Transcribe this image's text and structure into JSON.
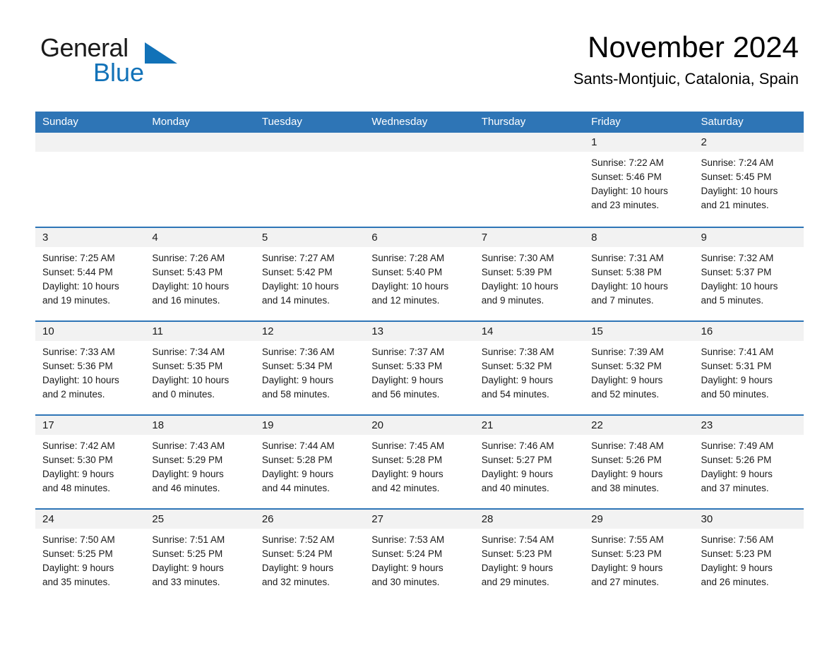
{
  "brand": {
    "line1": "General",
    "line2": "Blue",
    "triangle_color": "#1272b8"
  },
  "header": {
    "month_title": "November 2024",
    "location": "Sants-Montjuic, Catalonia, Spain"
  },
  "theme": {
    "header_blue": "#2e75b6",
    "day_band_gray": "#f2f2f2",
    "text": "#1a1a1a"
  },
  "calendar": {
    "weekday_headers": [
      "Sunday",
      "Monday",
      "Tuesday",
      "Wednesday",
      "Thursday",
      "Friday",
      "Saturday"
    ],
    "weeks": [
      [
        {
          "day": "",
          "empty": true
        },
        {
          "day": "",
          "empty": true
        },
        {
          "day": "",
          "empty": true
        },
        {
          "day": "",
          "empty": true
        },
        {
          "day": "",
          "empty": true
        },
        {
          "day": "1",
          "sunrise": "Sunrise: 7:22 AM",
          "sunset": "Sunset: 5:46 PM",
          "daylight_1": "Daylight: 10 hours",
          "daylight_2": "and 23 minutes."
        },
        {
          "day": "2",
          "sunrise": "Sunrise: 7:24 AM",
          "sunset": "Sunset: 5:45 PM",
          "daylight_1": "Daylight: 10 hours",
          "daylight_2": "and 21 minutes."
        }
      ],
      [
        {
          "day": "3",
          "sunrise": "Sunrise: 7:25 AM",
          "sunset": "Sunset: 5:44 PM",
          "daylight_1": "Daylight: 10 hours",
          "daylight_2": "and 19 minutes."
        },
        {
          "day": "4",
          "sunrise": "Sunrise: 7:26 AM",
          "sunset": "Sunset: 5:43 PM",
          "daylight_1": "Daylight: 10 hours",
          "daylight_2": "and 16 minutes."
        },
        {
          "day": "5",
          "sunrise": "Sunrise: 7:27 AM",
          "sunset": "Sunset: 5:42 PM",
          "daylight_1": "Daylight: 10 hours",
          "daylight_2": "and 14 minutes."
        },
        {
          "day": "6",
          "sunrise": "Sunrise: 7:28 AM",
          "sunset": "Sunset: 5:40 PM",
          "daylight_1": "Daylight: 10 hours",
          "daylight_2": "and 12 minutes."
        },
        {
          "day": "7",
          "sunrise": "Sunrise: 7:30 AM",
          "sunset": "Sunset: 5:39 PM",
          "daylight_1": "Daylight: 10 hours",
          "daylight_2": "and 9 minutes."
        },
        {
          "day": "8",
          "sunrise": "Sunrise: 7:31 AM",
          "sunset": "Sunset: 5:38 PM",
          "daylight_1": "Daylight: 10 hours",
          "daylight_2": "and 7 minutes."
        },
        {
          "day": "9",
          "sunrise": "Sunrise: 7:32 AM",
          "sunset": "Sunset: 5:37 PM",
          "daylight_1": "Daylight: 10 hours",
          "daylight_2": "and 5 minutes."
        }
      ],
      [
        {
          "day": "10",
          "sunrise": "Sunrise: 7:33 AM",
          "sunset": "Sunset: 5:36 PM",
          "daylight_1": "Daylight: 10 hours",
          "daylight_2": "and 2 minutes."
        },
        {
          "day": "11",
          "sunrise": "Sunrise: 7:34 AM",
          "sunset": "Sunset: 5:35 PM",
          "daylight_1": "Daylight: 10 hours",
          "daylight_2": "and 0 minutes."
        },
        {
          "day": "12",
          "sunrise": "Sunrise: 7:36 AM",
          "sunset": "Sunset: 5:34 PM",
          "daylight_1": "Daylight: 9 hours",
          "daylight_2": "and 58 minutes."
        },
        {
          "day": "13",
          "sunrise": "Sunrise: 7:37 AM",
          "sunset": "Sunset: 5:33 PM",
          "daylight_1": "Daylight: 9 hours",
          "daylight_2": "and 56 minutes."
        },
        {
          "day": "14",
          "sunrise": "Sunrise: 7:38 AM",
          "sunset": "Sunset: 5:32 PM",
          "daylight_1": "Daylight: 9 hours",
          "daylight_2": "and 54 minutes."
        },
        {
          "day": "15",
          "sunrise": "Sunrise: 7:39 AM",
          "sunset": "Sunset: 5:32 PM",
          "daylight_1": "Daylight: 9 hours",
          "daylight_2": "and 52 minutes."
        },
        {
          "day": "16",
          "sunrise": "Sunrise: 7:41 AM",
          "sunset": "Sunset: 5:31 PM",
          "daylight_1": "Daylight: 9 hours",
          "daylight_2": "and 50 minutes."
        }
      ],
      [
        {
          "day": "17",
          "sunrise": "Sunrise: 7:42 AM",
          "sunset": "Sunset: 5:30 PM",
          "daylight_1": "Daylight: 9 hours",
          "daylight_2": "and 48 minutes."
        },
        {
          "day": "18",
          "sunrise": "Sunrise: 7:43 AM",
          "sunset": "Sunset: 5:29 PM",
          "daylight_1": "Daylight: 9 hours",
          "daylight_2": "and 46 minutes."
        },
        {
          "day": "19",
          "sunrise": "Sunrise: 7:44 AM",
          "sunset": "Sunset: 5:28 PM",
          "daylight_1": "Daylight: 9 hours",
          "daylight_2": "and 44 minutes."
        },
        {
          "day": "20",
          "sunrise": "Sunrise: 7:45 AM",
          "sunset": "Sunset: 5:28 PM",
          "daylight_1": "Daylight: 9 hours",
          "daylight_2": "and 42 minutes."
        },
        {
          "day": "21",
          "sunrise": "Sunrise: 7:46 AM",
          "sunset": "Sunset: 5:27 PM",
          "daylight_1": "Daylight: 9 hours",
          "daylight_2": "and 40 minutes."
        },
        {
          "day": "22",
          "sunrise": "Sunrise: 7:48 AM",
          "sunset": "Sunset: 5:26 PM",
          "daylight_1": "Daylight: 9 hours",
          "daylight_2": "and 38 minutes."
        },
        {
          "day": "23",
          "sunrise": "Sunrise: 7:49 AM",
          "sunset": "Sunset: 5:26 PM",
          "daylight_1": "Daylight: 9 hours",
          "daylight_2": "and 37 minutes."
        }
      ],
      [
        {
          "day": "24",
          "sunrise": "Sunrise: 7:50 AM",
          "sunset": "Sunset: 5:25 PM",
          "daylight_1": "Daylight: 9 hours",
          "daylight_2": "and 35 minutes."
        },
        {
          "day": "25",
          "sunrise": "Sunrise: 7:51 AM",
          "sunset": "Sunset: 5:25 PM",
          "daylight_1": "Daylight: 9 hours",
          "daylight_2": "and 33 minutes."
        },
        {
          "day": "26",
          "sunrise": "Sunrise: 7:52 AM",
          "sunset": "Sunset: 5:24 PM",
          "daylight_1": "Daylight: 9 hours",
          "daylight_2": "and 32 minutes."
        },
        {
          "day": "27",
          "sunrise": "Sunrise: 7:53 AM",
          "sunset": "Sunset: 5:24 PM",
          "daylight_1": "Daylight: 9 hours",
          "daylight_2": "and 30 minutes."
        },
        {
          "day": "28",
          "sunrise": "Sunrise: 7:54 AM",
          "sunset": "Sunset: 5:23 PM",
          "daylight_1": "Daylight: 9 hours",
          "daylight_2": "and 29 minutes."
        },
        {
          "day": "29",
          "sunrise": "Sunrise: 7:55 AM",
          "sunset": "Sunset: 5:23 PM",
          "daylight_1": "Daylight: 9 hours",
          "daylight_2": "and 27 minutes."
        },
        {
          "day": "30",
          "sunrise": "Sunrise: 7:56 AM",
          "sunset": "Sunset: 5:23 PM",
          "daylight_1": "Daylight: 9 hours",
          "daylight_2": "and 26 minutes."
        }
      ]
    ]
  }
}
